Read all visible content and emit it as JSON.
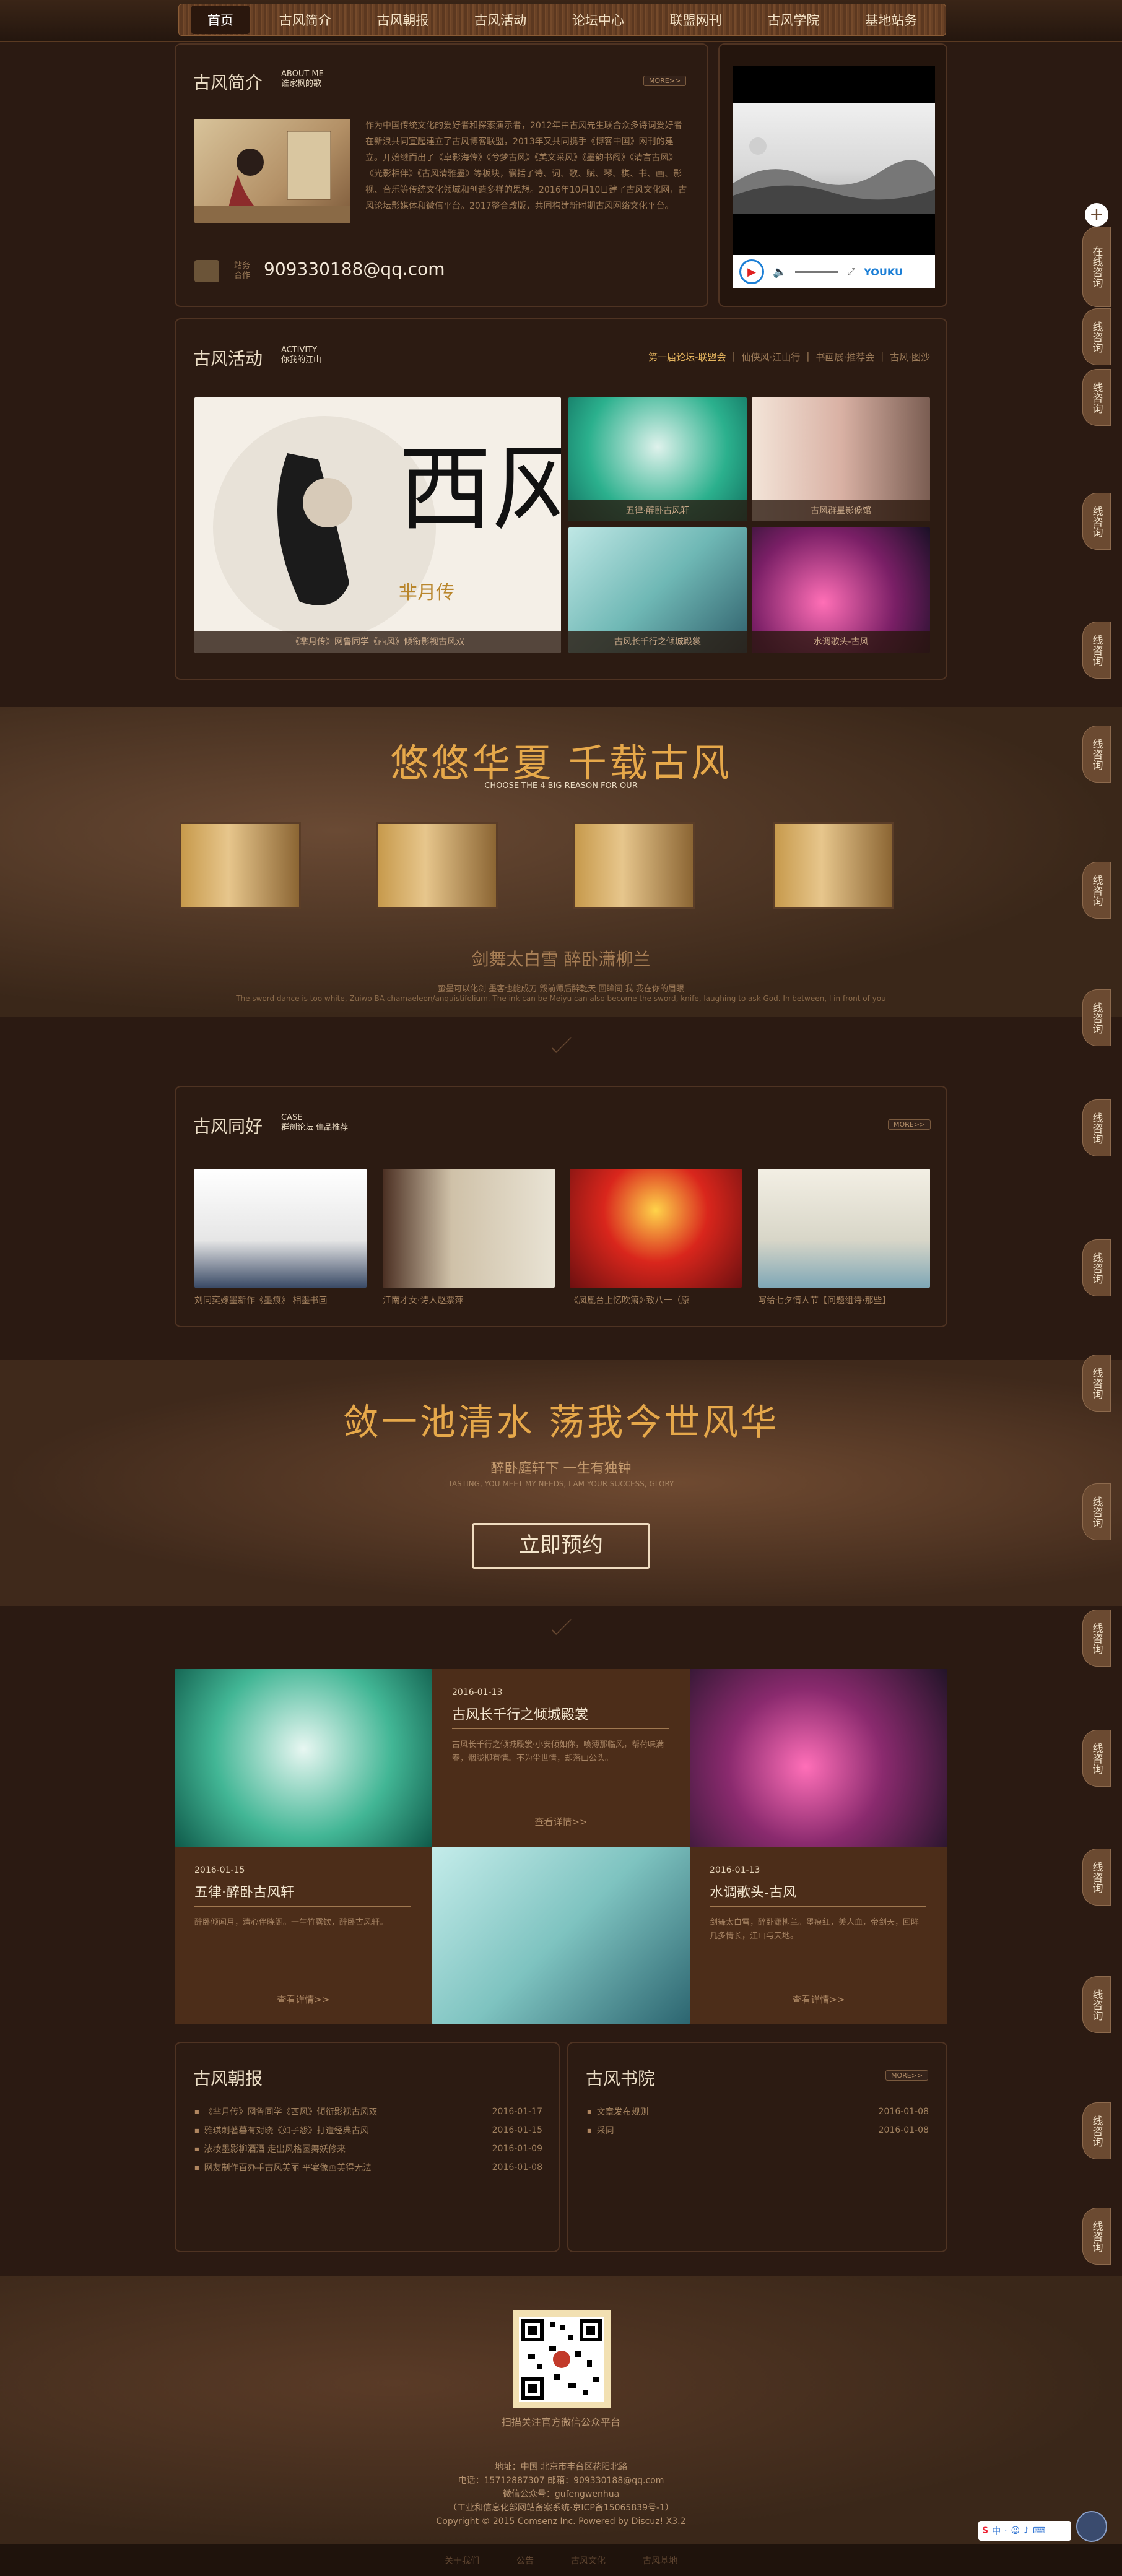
{
  "nav": {
    "items": [
      "首页",
      "古风简介",
      "古风朝报",
      "古风活动",
      "论坛中心",
      "联盟网刊",
      "古风学院",
      "基地站务"
    ]
  },
  "intro": {
    "title": "古风简介",
    "sub1": "ABOUT ME",
    "sub2": "谁家枫的歌",
    "more": "MORE>>",
    "text": "作为中国传统文化的爱好者和探索演示者，2012年由古风先生联合众多诗词爱好者在新浪共同宣起建立了古风博客联盟，2013年又共同携手《博客中国》网刊的建立。开始继而出了《卓影海传》《兮梦古风》《美文采风》《墨韵书阁》《清言古风》《光影相伴》《古风清雅墨》等板块，囊括了诗、词、歌、赋、琴、棋、书、画、影视、音乐等传统文化领域和创造多样的思想。2016年10月10日建了古风文化网，古风论坛影媒体和微信平台。2017整合改版，共同构建新时期古风网络文化平台。",
    "contact_label1": "站务",
    "contact_label2": "合作",
    "email": "909330188@qq.com"
  },
  "video": {
    "brand": "YOUKU"
  },
  "activity": {
    "title": "古风活动",
    "sub1": "ACTIVITY",
    "sub2": "你我的江山",
    "links": [
      "第一届论坛-联盟会",
      "仙侠风·江山行",
      "书画展·推荐会",
      "古风·图沙"
    ],
    "big_caption": "《芈月传》网鲁同学《西风》倾衔影视古风双",
    "big_art": "西风",
    "big_name": "芈月传",
    "thumbs": [
      {
        "caption": "五律·醉卧古风轩"
      },
      {
        "caption": "古风群星影像馆"
      },
      {
        "caption": "古风长千行之倾城殿裳"
      },
      {
        "caption": "水调歌头-古风"
      }
    ]
  },
  "band1": {
    "title": "悠悠华夏 千载古风",
    "sub": "CHOOSE THE 4 BIG REASON FOR OUR",
    "phrase": "剑舞太白雪 醉卧潇柳兰",
    "line_cn": "蛰墨可以化剑 墨客也能成刀 毁前师后醉乾天 回眸间 我 我在你的眉眼",
    "line_en": "The sword dance is too white, Zuiwo BA chamaeleon/anquistifolium. The ink can be Meiyu can also become the sword, knife, laughing to ask God. In between, I in front of you"
  },
  "friends": {
    "title": "古风同好",
    "sub1": "CASE",
    "sub2": "群创论坛 佳品推荐",
    "more": "MORE>>",
    "items": [
      {
        "caption": "刘同奕嫁墨新作《墨痕》 相墨书画"
      },
      {
        "caption": "江南才女·诗人赵票萍"
      },
      {
        "caption": "《凤凰台上忆吹箫》·致八一（原"
      },
      {
        "caption": "写给七夕情人节【问题组诗·那些】"
      }
    ]
  },
  "band2": {
    "title": "敛一池清水 荡我今世风华",
    "sub_cn": "醉卧庭轩下 一生有独钟",
    "sub_en": "TASTING, YOU MEET MY NEEDS, I AM YOUR SUCCESS, GLORY",
    "button": "立即预约"
  },
  "cards": [
    {
      "date": "2016-01-13",
      "title": "古风长千行之倾城殿裳",
      "text": "古风长千行之倾城殿裳·小安倾如你，喷薄那临风，帮荷味满春，烟胧柳有情。不为尘世情，却落山公头。",
      "link": "查看详情>>"
    },
    {
      "date": "2016-01-15",
      "title": "五律·醉卧古风轩",
      "text": "醉卧倾闻月，清心伴晓阁。一生竹露饮，醉卧古风轩。",
      "link": "查看详情>>"
    },
    {
      "date": "2016-01-13",
      "title": "水调歌头-古风",
      "text": "剑舞太白雪，醉卧潇柳兰。墨痕红，美人血，帝剑天，回眸几多情长，江山与天地。",
      "link": "查看详情>>"
    }
  ],
  "news": {
    "title": "古风朝报",
    "items": [
      {
        "t": "《芈月传》网鲁同学《西风》倾衔影视古风双",
        "d": "2016-01-17"
      },
      {
        "t": "雅琪刺著暮有对晓《如子怨》打造经典古风",
        "d": "2016-01-15"
      },
      {
        "t": "浓妆墨影柳酒酒 走出风格圆舞妖修来",
        "d": "2016-01-09"
      },
      {
        "t": "网友制作百办手古风美丽 平宴像画美得无法",
        "d": "2016-01-08"
      }
    ]
  },
  "academy": {
    "title": "古风书院",
    "more": "MORE>>",
    "items": [
      {
        "t": "文章发布规则",
        "d": "2016-01-08"
      },
      {
        "t": "采同",
        "d": "2016-01-08"
      }
    ]
  },
  "footer": {
    "qr_caption": "扫描关注官方微信公众平台",
    "lines": [
      "地址：中国 北京市丰台区花阳北路",
      "电话：15712887307    邮箱：909330188@qq.com",
      "微信公众号：gufengwenhua",
      "（工业和信息化部网站备案系统·京ICP备15065839号-1）",
      "Copyright © 2015 Comsenz Inc. Powered by Discuz! X3.2"
    ],
    "bottom_links": [
      "关于我们",
      "公告",
      "古风文化",
      "古风基地"
    ]
  },
  "side": {
    "top_label": "在线咨询",
    "tab_label": "线咨询"
  },
  "colors": {
    "accent": "#e6a84a",
    "bg": "#2b1a12",
    "panel_border": "#4f3322"
  }
}
